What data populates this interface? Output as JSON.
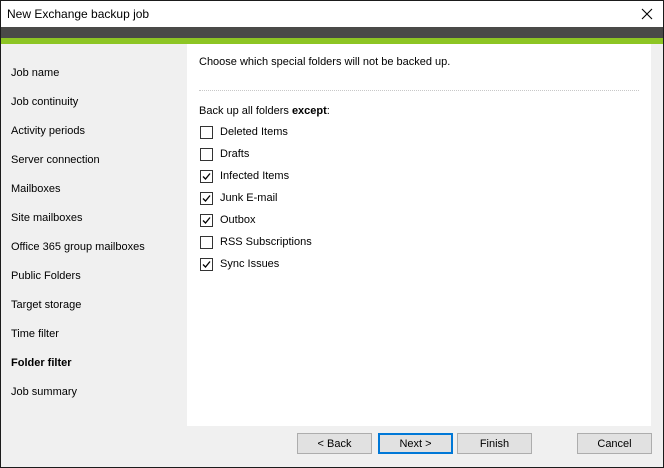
{
  "window": {
    "title": "New Exchange backup job"
  },
  "sidebar": {
    "items": [
      {
        "label": "Job name",
        "active": false
      },
      {
        "label": "Job continuity",
        "active": false
      },
      {
        "label": "Activity periods",
        "active": false
      },
      {
        "label": "Server connection",
        "active": false
      },
      {
        "label": "Mailboxes",
        "active": false
      },
      {
        "label": "Site mailboxes",
        "active": false
      },
      {
        "label": "Office 365 group mailboxes",
        "active": false
      },
      {
        "label": "Public Folders",
        "active": false
      },
      {
        "label": "Target storage",
        "active": false
      },
      {
        "label": "Time filter",
        "active": false
      },
      {
        "label": "Folder filter",
        "active": true
      },
      {
        "label": "Job summary",
        "active": false
      }
    ]
  },
  "content": {
    "instruction": "Choose which special folders will not be backed up.",
    "except_prefix": "Back up all folders ",
    "except_bold": "except",
    "except_suffix": ":",
    "folders": [
      {
        "label": "Deleted Items",
        "checked": false
      },
      {
        "label": "Drafts",
        "checked": false
      },
      {
        "label": "Infected Items",
        "checked": true
      },
      {
        "label": "Junk E-mail",
        "checked": true
      },
      {
        "label": "Outbox",
        "checked": true
      },
      {
        "label": "RSS Subscriptions",
        "checked": false
      },
      {
        "label": "Sync Issues",
        "checked": true
      }
    ]
  },
  "buttons": {
    "back": "< Back",
    "next": "Next >",
    "finish": "Finish",
    "cancel": "Cancel"
  },
  "colors": {
    "accent_green": "#8dc524",
    "header_dark": "#4a4a48",
    "focus_blue": "#0078d7"
  },
  "icons": {
    "close": "close-icon",
    "checkmark": "checkmark-icon"
  }
}
